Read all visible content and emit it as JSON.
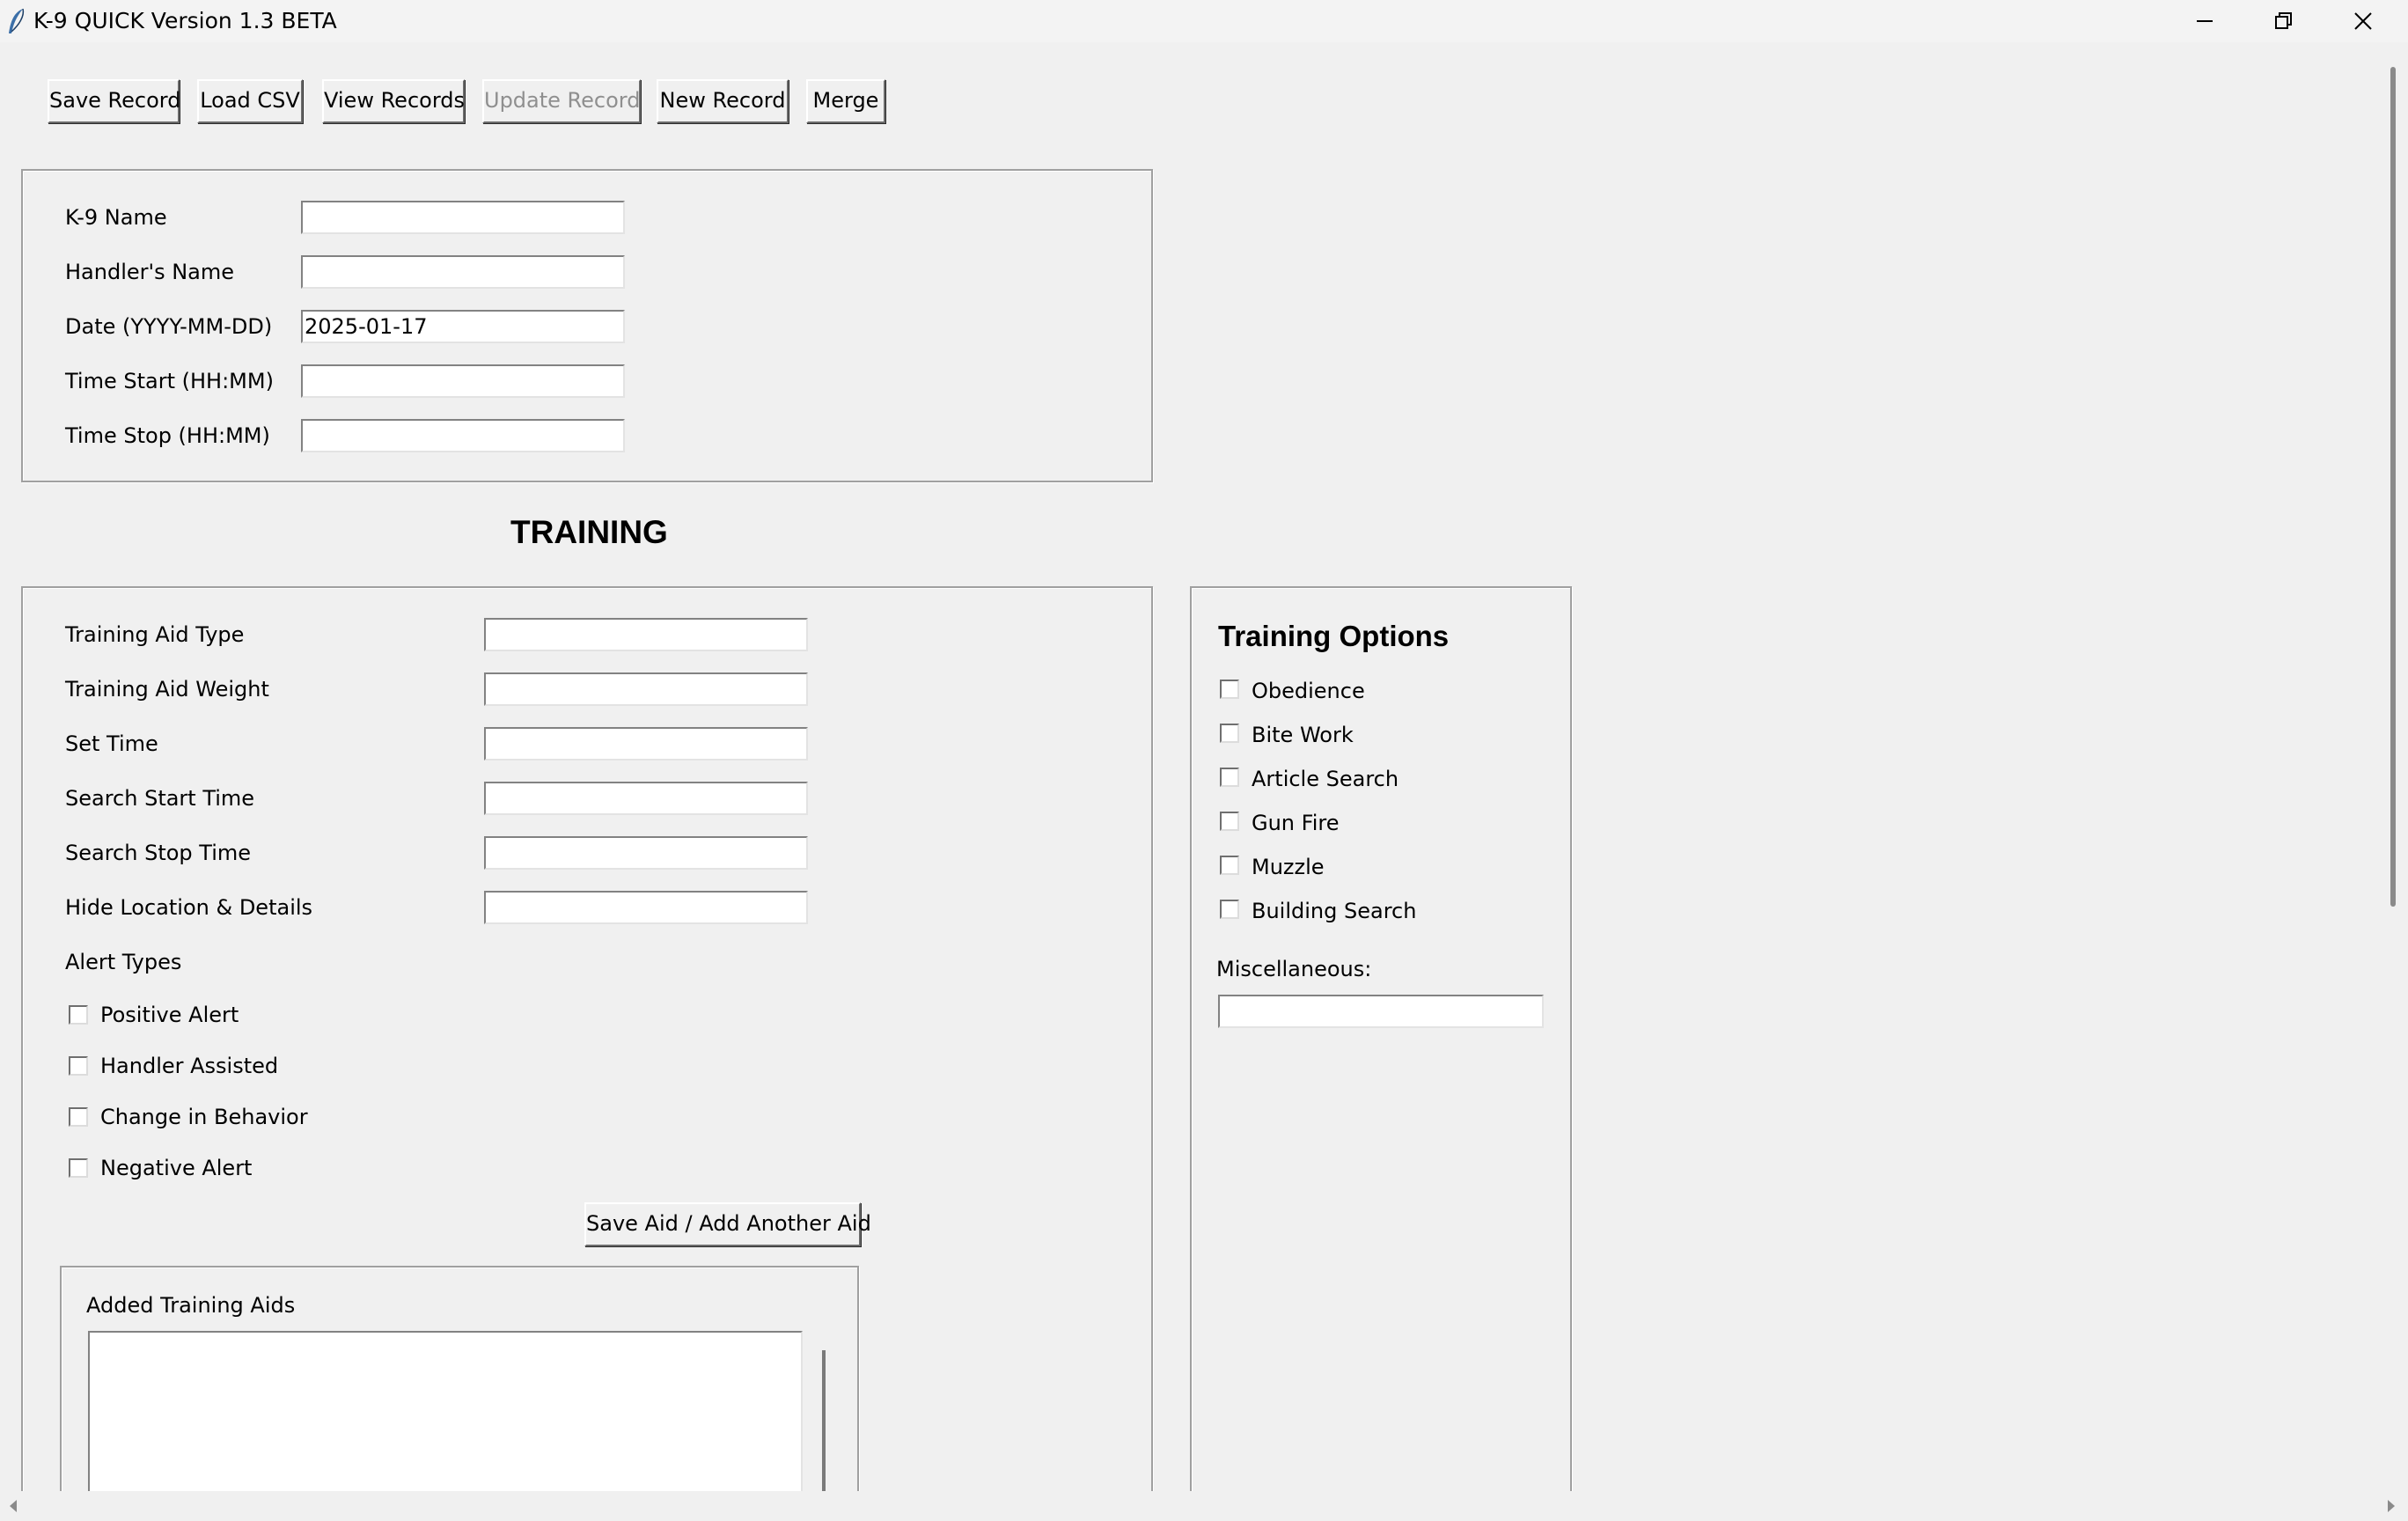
{
  "window": {
    "title": "K-9 QUICK Version 1.3 BETA"
  },
  "toolbar": {
    "save_record": "Save Record",
    "load_csv": "Load CSV",
    "view_records": "View Records",
    "update_record": "Update Record",
    "new_record": "New Record",
    "merge": "Merge"
  },
  "record": {
    "k9_name_label": "K-9 Name",
    "k9_name_value": "",
    "handler_label": "Handler's Name",
    "handler_value": "",
    "date_label": "Date (YYYY-MM-DD)",
    "date_value": "2025-01-17",
    "time_start_label": "Time Start (HH:MM)",
    "time_start_value": "",
    "time_stop_label": "Time Stop (HH:MM)",
    "time_stop_value": ""
  },
  "training": {
    "heading": "TRAINING",
    "aid_type_label": "Training Aid Type",
    "aid_weight_label": "Training Aid Weight",
    "set_time_label": "Set Time",
    "search_start_label": "Search Start Time",
    "search_stop_label": "Search Stop Time",
    "hide_location_label": "Hide Location & Details",
    "alert_types_label": "Alert Types",
    "alerts": [
      "Positive Alert",
      "Handler Assisted",
      "Change in Behavior",
      "Negative Alert"
    ],
    "save_aid_button": "Save Aid / Add Another Aid",
    "added_aids_label": "Added Training Aids"
  },
  "options": {
    "heading": "Training Options",
    "items": [
      "Obedience",
      "Bite Work",
      "Article Search",
      "Gun Fire",
      "Muzzle",
      "Building Search"
    ],
    "misc_label": "Miscellaneous:",
    "misc_value": ""
  }
}
